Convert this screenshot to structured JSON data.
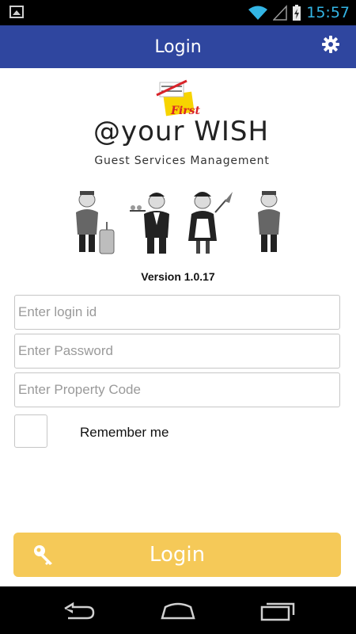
{
  "status_bar": {
    "time": "15:57",
    "accent": "#33b5e5"
  },
  "app_bar": {
    "title": "Login",
    "color": "#2f469f",
    "settings_icon": "gear-icon"
  },
  "logo": {
    "badge_text": "First",
    "brand": "@your WISH",
    "tagline": "Guest Services Management"
  },
  "version": "Version 1.0.17",
  "form": {
    "login_placeholder": "Enter login id",
    "login_value": "",
    "password_placeholder": "Enter Password",
    "password_value": "",
    "property_placeholder": "Enter Property Code",
    "property_value": "",
    "remember_label": "Remember me",
    "remember_checked": false
  },
  "login_button": {
    "label": "Login",
    "color": "#f5c958",
    "icon": "key-icon"
  },
  "nav_bar": {
    "icons": [
      "back-icon",
      "home-icon",
      "recent-apps-icon"
    ]
  }
}
